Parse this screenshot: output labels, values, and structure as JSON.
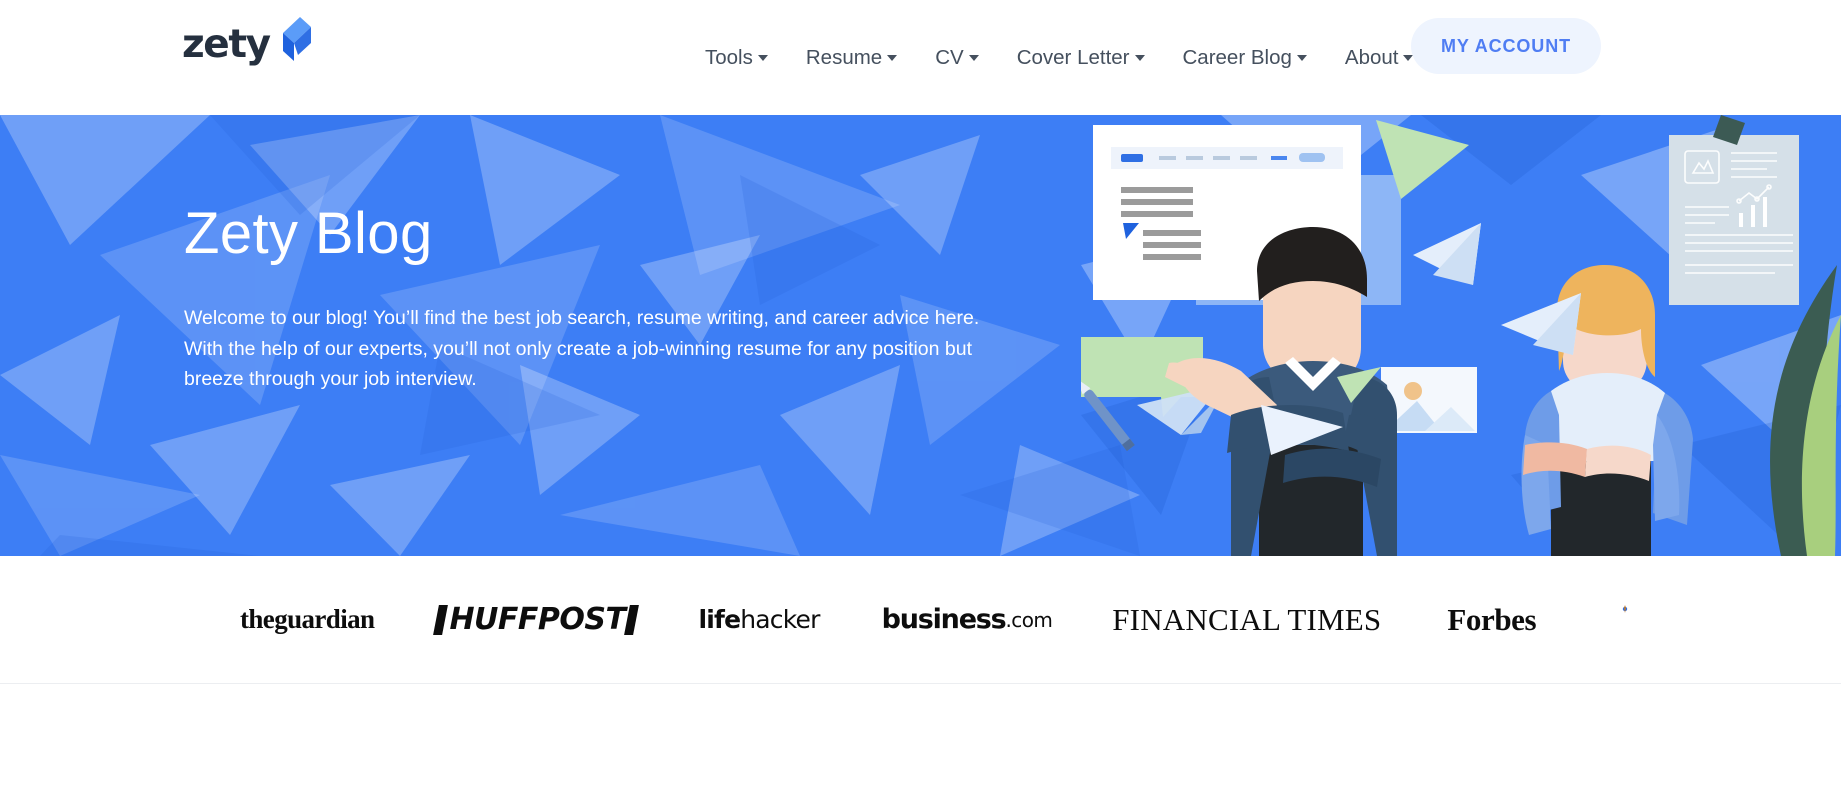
{
  "header": {
    "logo": {
      "text": "zety",
      "mark_icon": "zety-arrow-logo",
      "text_color": "#25303f",
      "mark_color": "#3d7ef5"
    },
    "nav_items": [
      {
        "label": "Tools",
        "has_dropdown": true,
        "icon": "chevron-down-icon"
      },
      {
        "label": "Resume",
        "has_dropdown": true,
        "icon": "chevron-down-icon"
      },
      {
        "label": "CV",
        "has_dropdown": true,
        "icon": "chevron-down-icon"
      },
      {
        "label": "Cover Letter",
        "has_dropdown": true,
        "icon": "chevron-down-icon"
      },
      {
        "label": "Career Blog",
        "has_dropdown": true,
        "icon": "chevron-down-icon"
      },
      {
        "label": "About",
        "has_dropdown": true,
        "icon": "chevron-down-icon"
      }
    ],
    "account_button": {
      "label": "MY ACCOUNT",
      "text_color": "#4f7df3",
      "background_color": "#eef4fe"
    }
  },
  "hero": {
    "title": "Zety Blog",
    "paragraph": "Welcome to our blog! You’ll find the best job search, resume writing, and career advice here. With the help of our experts, you’ll not only create a job-winning resume for any position but breeze through your job interview.",
    "background_color": "#3d7ef5",
    "text_color": "#ffffff",
    "illustration": "two-professionals-with-resume-documents-illustration"
  },
  "press_strip": {
    "logos": [
      {
        "name": "theguardian",
        "label": "theguardian"
      },
      {
        "name": "huffpost",
        "label": "HUFFPOST"
      },
      {
        "name": "lifehacker",
        "label_bold": "life",
        "label_light": "hacker"
      },
      {
        "name": "business-com",
        "label_bold": "business",
        "label_light": ".com"
      },
      {
        "name": "financial-times",
        "label": "FINANCIAL TIMES"
      },
      {
        "name": "forbes",
        "label": "Forbes"
      },
      {
        "name": "partial-logo",
        "label": ""
      }
    ],
    "text_color": "#0d0d0d",
    "background_color": "#ffffff"
  }
}
